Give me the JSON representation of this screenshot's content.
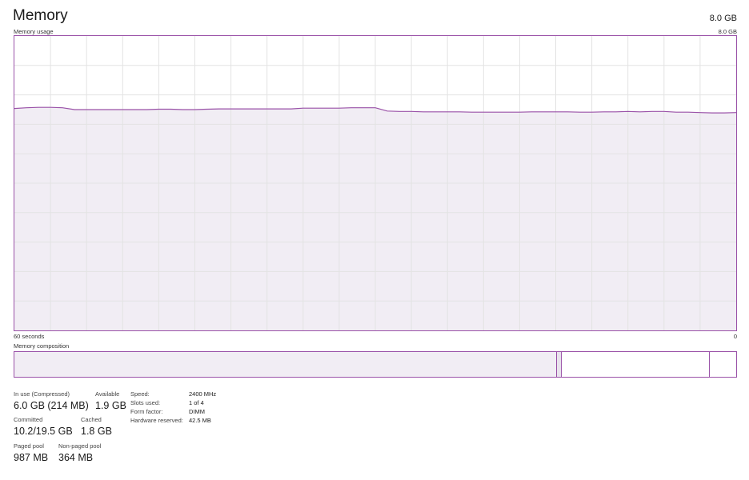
{
  "header": {
    "title": "Memory",
    "total": "8.0 GB"
  },
  "graph": {
    "label": "Memory usage",
    "max_label": "8.0 GB",
    "time_left": "60 seconds",
    "time_right": "0",
    "max_gb": 8.0,
    "usage_gb": [
      6.03,
      6.05,
      6.06,
      6.06,
      6.05,
      6.0,
      6.0,
      6.0,
      6.0,
      6.0,
      6.0,
      6.0,
      6.01,
      6.01,
      6.0,
      6.0,
      6.01,
      6.02,
      6.02,
      6.02,
      6.02,
      6.02,
      6.02,
      6.02,
      6.04,
      6.04,
      6.04,
      6.04,
      6.05,
      6.05,
      6.05,
      5.96,
      5.95,
      5.95,
      5.94,
      5.94,
      5.94,
      5.94,
      5.93,
      5.93,
      5.93,
      5.93,
      5.93,
      5.94,
      5.94,
      5.94,
      5.94,
      5.93,
      5.93,
      5.94,
      5.94,
      5.95,
      5.94,
      5.95,
      5.95,
      5.93,
      5.93,
      5.92,
      5.91,
      5.91,
      5.92
    ],
    "colors": {
      "line": "#9a52a8",
      "fill": "#f1edf4",
      "grid": "#e3e3e3",
      "border": "#9a52a8"
    }
  },
  "composition": {
    "label": "Memory composition",
    "in_use_gb": 6.0,
    "modified_gb": 0.06,
    "standby_gb": 1.64,
    "free_gb": 0.07,
    "total_gb": 8.0,
    "colors": {
      "in_use": "#f1edf4",
      "modified": "#e8e2ec",
      "standby": "#ffffff",
      "free": "#ffffff",
      "divider": "#9a52a8"
    }
  },
  "stats": {
    "in_use_label": "In use (Compressed)",
    "in_use_value": "6.0 GB (214 MB)",
    "available_label": "Available",
    "available_value": "1.9 GB",
    "committed_label": "Committed",
    "committed_value": "10.2/19.5 GB",
    "cached_label": "Cached",
    "cached_value": "1.8 GB",
    "paged_label": "Paged pool",
    "paged_value": "987 MB",
    "nonpaged_label": "Non-paged pool",
    "nonpaged_value": "364 MB"
  },
  "details": [
    {
      "label": "Speed:",
      "value": "2400 MHz"
    },
    {
      "label": "Slots used:",
      "value": "1 of 4"
    },
    {
      "label": "Form factor:",
      "value": "DIMM"
    },
    {
      "label": "Hardware reserved:",
      "value": "42.5 MB"
    }
  ]
}
